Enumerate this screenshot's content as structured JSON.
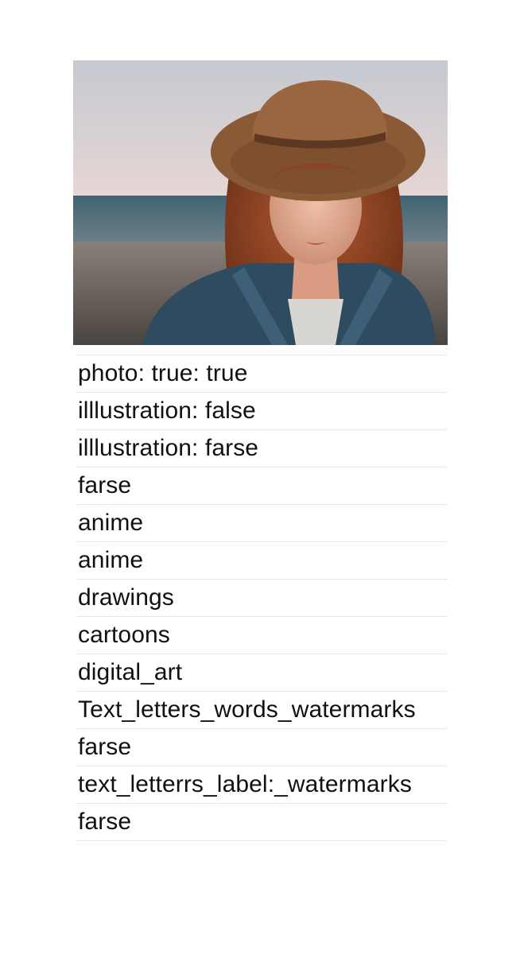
{
  "image": {
    "subject": "portrait-photo",
    "colors": {
      "sky_top": "#c9ccd2",
      "sky_bottom": "#e4d6d3",
      "sea": "#4a6b78",
      "sand": "#7a706a",
      "hat": "#8a5a36",
      "hair": "#9a4b2a",
      "skin": "#e0a98f",
      "jacket": "#2f4a5e"
    }
  },
  "list": {
    "items": [
      "photo:  true:  true",
      "illlustration:  false",
      "illlustration:  farse",
      "farse",
      "anime",
      "anime",
      "drawings",
      "cartoons",
      "digital_art",
      "Text_letters_words_watermarks",
      "farse",
      "text_letterrs_label:_watermarks",
      "farse"
    ]
  }
}
